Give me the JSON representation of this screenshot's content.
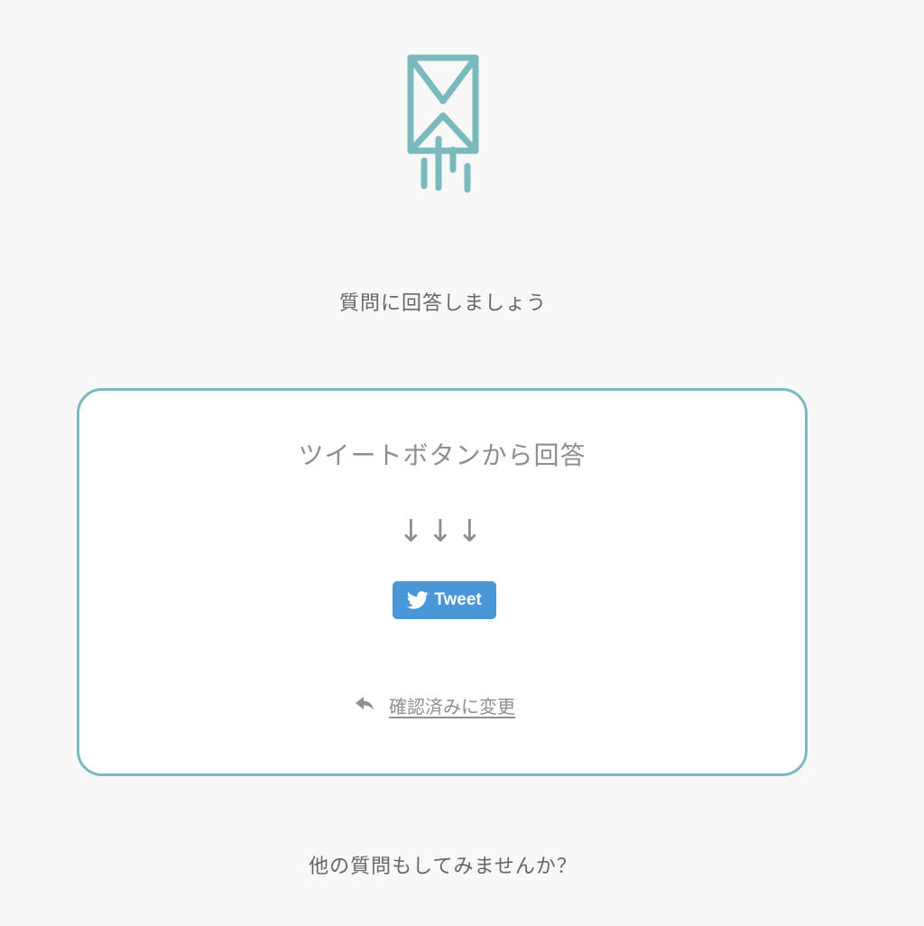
{
  "icons": {
    "hero": "envelope-send-icon",
    "tweet": "twitter-bird-icon",
    "confirm": "reply-arrow-icon"
  },
  "colors": {
    "background": "#f8f8f8",
    "accent": "#7ab9bd",
    "tweet_button": "#4a97d8",
    "text": "#666666",
    "muted_text": "#8e8e8e"
  },
  "prompt": "質問に回答しましょう",
  "card": {
    "heading": "ツイートボタンから回答",
    "arrows": "↓↓↓",
    "tweet_label": "Tweet",
    "confirm_label": "確認済みに変更"
  },
  "footer": {
    "question": "他の質問もしてみませんか？"
  }
}
